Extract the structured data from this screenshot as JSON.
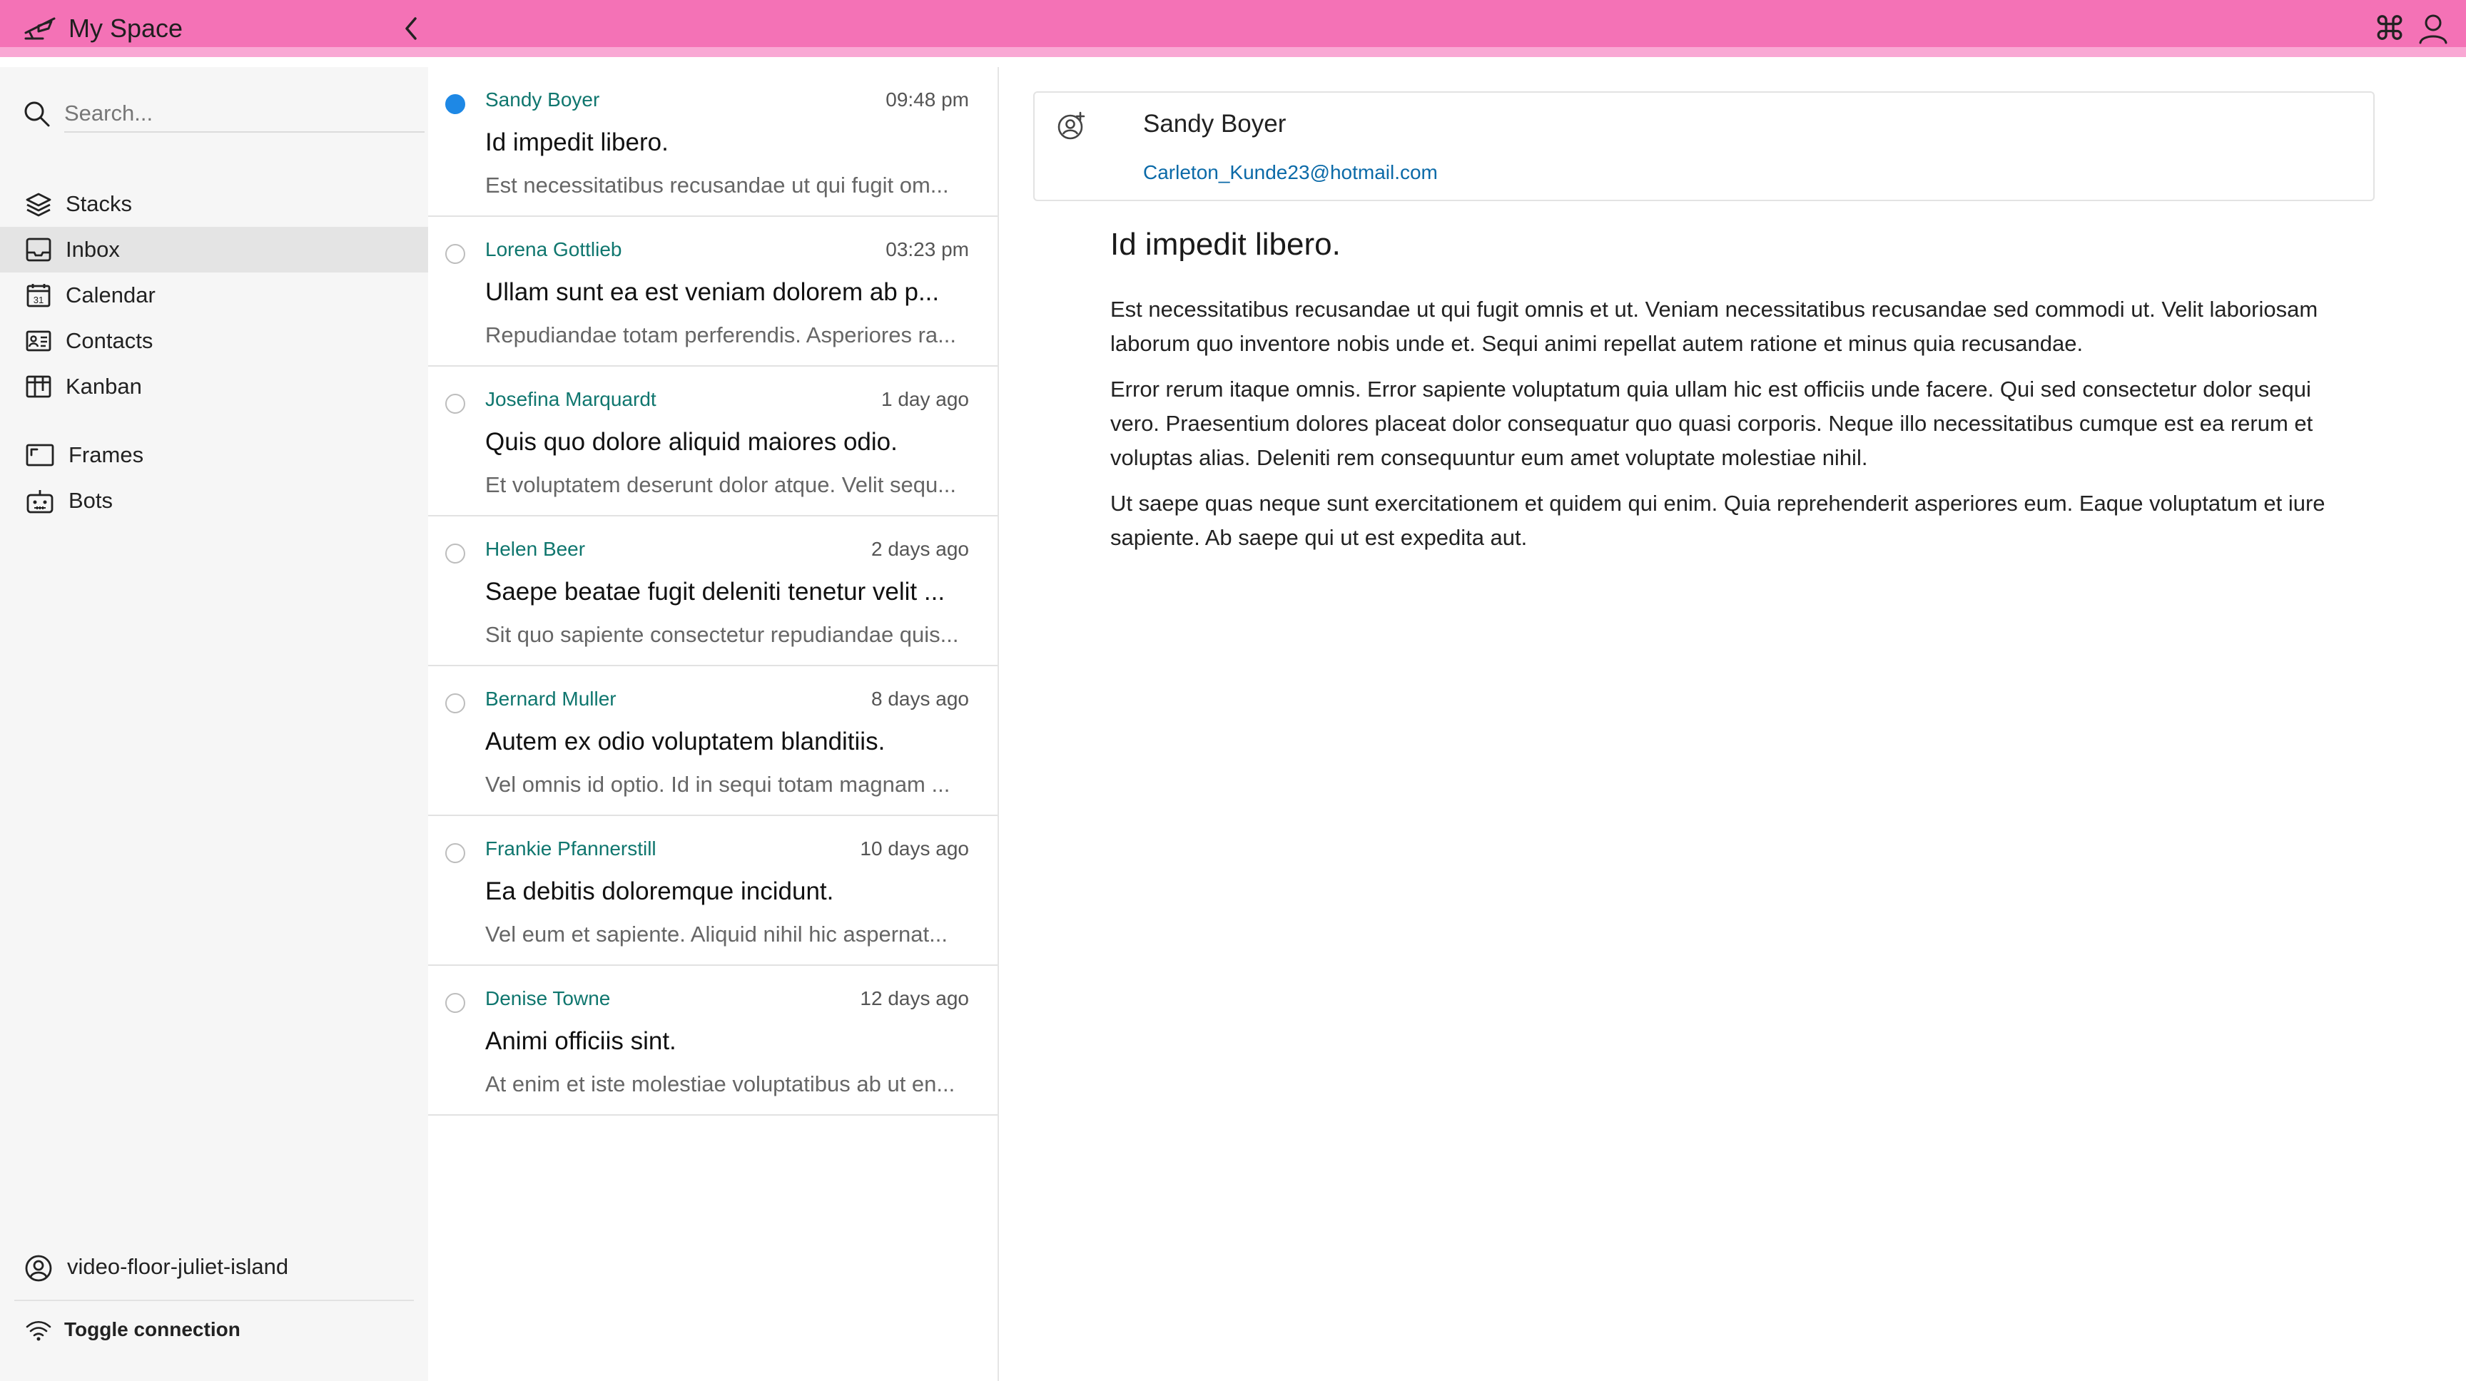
{
  "app": {
    "title": "My Space"
  },
  "search": {
    "placeholder": "Search..."
  },
  "sidebar": {
    "items": [
      {
        "label": "Stacks",
        "icon": "stacks-icon"
      },
      {
        "label": "Inbox",
        "icon": "inbox-icon",
        "active": true
      },
      {
        "label": "Calendar",
        "icon": "calendar-icon"
      },
      {
        "label": "Contacts",
        "icon": "contacts-icon"
      },
      {
        "label": "Kanban",
        "icon": "kanban-icon"
      },
      {
        "label": "Frames",
        "icon": "frames-icon"
      },
      {
        "label": "Bots",
        "icon": "bots-icon"
      }
    ],
    "account": "video-floor-juliet-island",
    "toggle": "Toggle connection"
  },
  "messages": [
    {
      "sender": "Sandy Boyer",
      "time": "09:48 pm",
      "subject": "Id impedit libero.",
      "preview": "Est necessitatibus recusandae ut qui fugit om...",
      "selected": true
    },
    {
      "sender": "Lorena Gottlieb",
      "time": "03:23 pm",
      "subject": "Ullam sunt ea est veniam dolorem ab p...",
      "preview": "Repudiandae totam perferendis. Asperiores ra..."
    },
    {
      "sender": "Josefina Marquardt",
      "time": "1 day ago",
      "subject": "Quis quo dolore aliquid maiores odio.",
      "preview": "Et voluptatem deserunt dolor atque. Velit sequ..."
    },
    {
      "sender": "Helen Beer",
      "time": "2 days ago",
      "subject": "Saepe beatae fugit deleniti tenetur velit ...",
      "preview": "Sit quo sapiente consectetur repudiandae quis..."
    },
    {
      "sender": "Bernard Muller",
      "time": "8 days ago",
      "subject": "Autem ex odio voluptatem blanditiis.",
      "preview": "Vel omnis id optio. Id in sequi totam magnam ..."
    },
    {
      "sender": "Frankie Pfannerstill",
      "time": "10 days ago",
      "subject": "Ea debitis doloremque incidunt.",
      "preview": "Vel eum et sapiente. Aliquid nihil hic aspernat..."
    },
    {
      "sender": "Denise Towne",
      "time": "12 days ago",
      "subject": "Animi officiis sint.",
      "preview": "At enim et iste molestiae voluptatibus ab ut en..."
    }
  ],
  "reader": {
    "contact_name": "Sandy Boyer",
    "contact_email": "Carleton_Kunde23@hotmail.com",
    "subject": "Id impedit libero.",
    "paragraphs": [
      "Est necessitatibus recusandae ut qui fugit omnis et ut. Veniam necessitatibus recusandae sed commodi ut. Velit laboriosam laborum quo inventore nobis unde et. Sequi animi repellat autem ratione et minus quia recusandae.",
      "Error rerum itaque omnis. Error sapiente voluptatum quia ullam hic est officiis unde facere. Qui sed consectetur dolor sequi vero. Praesentium dolores placeat dolor consequatur quo quasi corporis. Neque illo necessitatibus cumque est ea rerum et voluptas alias. Deleniti rem consequuntur eum amet voluptate molestiae nihil.",
      "Ut saepe quas neque sunt exercitationem et quidem qui enim. Quia reprehenderit asperiores eum. Eaque voluptatum et iure sapiente. Ab saepe qui ut est expedita aut."
    ]
  },
  "colors": {
    "topbar": "#f472b6",
    "topbar_border": "#f9a8d4",
    "accent": "#1e88e5",
    "sender": "#0f766e",
    "link": "#0b6aa8"
  },
  "topbar_icons": [
    "app-logo-icon",
    "collapse-chevron-icon",
    "command-icon",
    "user-icon"
  ]
}
